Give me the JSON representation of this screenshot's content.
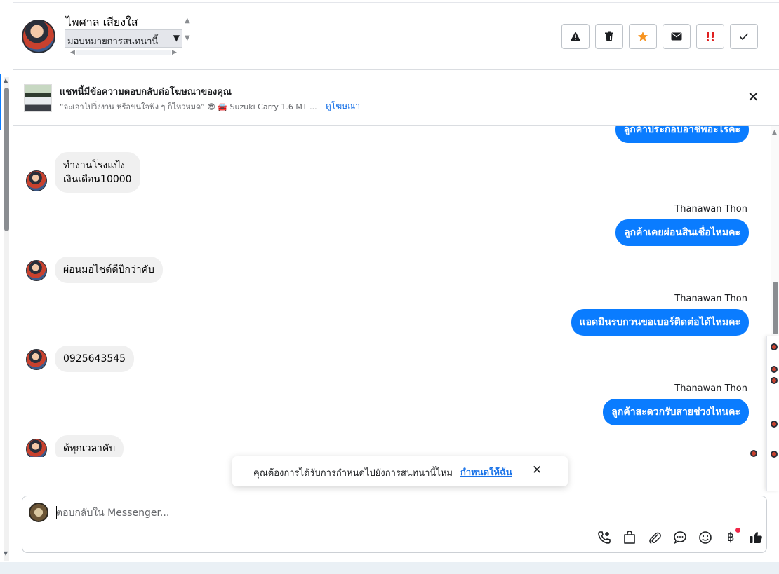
{
  "header": {
    "contact_name": "ไพศาล เสียงใส",
    "assign_label": "มอบหมายการสนทนานี้"
  },
  "actions": [
    {
      "name": "report-button",
      "icon": "warning-icon"
    },
    {
      "name": "delete-button",
      "icon": "trash-icon"
    },
    {
      "name": "star-button",
      "icon": "star-icon"
    },
    {
      "name": "mark-unread-button",
      "icon": "envelope-icon"
    },
    {
      "name": "follow-up-button",
      "icon": "important-icon"
    },
    {
      "name": "mark-done-button",
      "icon": "check-icon"
    }
  ],
  "ad_banner": {
    "title": "แชทนี้มีข้อความตอบกลับต่อโฆษณาของคุณ",
    "description": "“จะเอาไปวิ่งงาน หรือขนใจฟัง ๆ ก็ไหวหมด” 😎 🚘 Suzuki Carry 1.6 MT ...",
    "link": "ดูโฆษณา"
  },
  "messages": {
    "partial_top": "ลูกค้าประกอบอาชีพอะไรคะ",
    "m1_line1": "ทำงานโรงแป้ง",
    "m1_line2": "เงินเดือน10000",
    "sender": "Thanawan Thon",
    "o1": "ลูกค้าเคยผ่อนสินเชื่อไหมคะ",
    "m2": "ผ่อนมอไชด์ดีปีกว่าคับ",
    "o2": "แอดมินรบกวนขอเบอร์ติดต่อได้ไหมคะ",
    "m3": "0925643545",
    "o3": "ลูกค้าสะดวกรับสายช่วงไหนคะ",
    "m4": "ด้ทุกเวลาคับ"
  },
  "toast": {
    "text": "คุณต้องการได้รับการกำหนดไปยังการสนทนานี้ไหม",
    "link": "กำหนดให้ฉัน"
  },
  "composer": {
    "placeholder": "ตอบกลับใน Messenger..."
  },
  "colors": {
    "outgoing_bubble": "#0a7cff",
    "incoming_bubble": "#f0f0f0",
    "star": "#f7931e",
    "important": "#e02020",
    "link": "#1a73e8"
  }
}
